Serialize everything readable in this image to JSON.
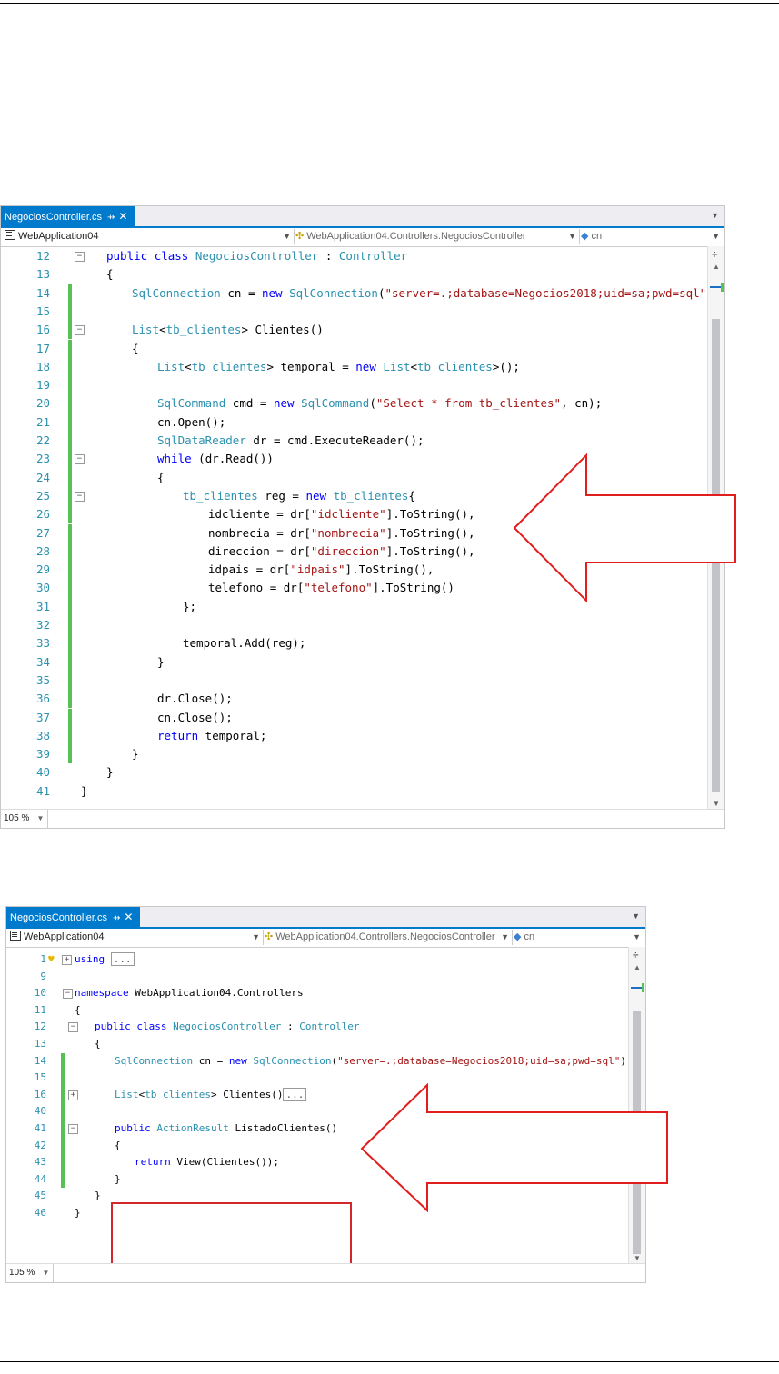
{
  "colors": {
    "accent": "#007acc",
    "keyword": "#0000ff",
    "type": "#2b91af",
    "string": "#a31515",
    "changed": "#57c155",
    "arrow": "#e11d1d"
  },
  "window1": {
    "tab": {
      "title": "NegociosController.cs",
      "pin": "⇸",
      "close": "✕"
    },
    "nav": {
      "project": "WebApplication04",
      "class": "WebApplication04.Controllers.NegociosController",
      "member": "cn"
    },
    "zoom": "105 %",
    "lines": [
      {
        "n": "12",
        "html": "<span class='kw'>public</span> <span class='kw'>class</span> <span class='ty'>NegociosController</span> : <span class='ty'>Controller</span>"
      },
      {
        "n": "13",
        "html": "{"
      },
      {
        "n": "14",
        "html": "<span class='ty'>SqlConnection</span> cn = <span class='kw'>new</span> <span class='ty'>SqlConnection</span>(<span class='st'>\"server=.;database=Negocios2018;uid=sa;pwd=sql\"</span>);"
      },
      {
        "n": "15",
        "html": ""
      },
      {
        "n": "16",
        "html": "<span class='ty'>List</span>&lt;<span class='ty'>tb_clientes</span>&gt; Clientes()"
      },
      {
        "n": "17",
        "html": "{"
      },
      {
        "n": "18",
        "html": "<span class='ty'>List</span>&lt;<span class='ty'>tb_clientes</span>&gt; temporal = <span class='kw'>new</span> <span class='ty'>List</span>&lt;<span class='ty'>tb_clientes</span>&gt;();"
      },
      {
        "n": "19",
        "html": ""
      },
      {
        "n": "20",
        "html": "<span class='ty'>SqlCommand</span> cmd = <span class='kw'>new</span> <span class='ty'>SqlCommand</span>(<span class='st'>\"Select * from tb_clientes\"</span>, cn);"
      },
      {
        "n": "21",
        "html": "cn.Open();"
      },
      {
        "n": "22",
        "html": "<span class='ty'>SqlDataReader</span> dr = cmd.ExecuteReader();"
      },
      {
        "n": "23",
        "html": "<span class='kw'>while</span> (dr.Read())"
      },
      {
        "n": "24",
        "html": "{"
      },
      {
        "n": "25",
        "html": "<span class='ty'>tb_clientes</span> reg = <span class='kw'>new</span> <span class='ty'>tb_clientes</span>{"
      },
      {
        "n": "26",
        "html": "idcliente = dr[<span class='st'>\"idcliente\"</span>].ToString(),"
      },
      {
        "n": "27",
        "html": "nombrecia = dr[<span class='st'>\"nombrecia\"</span>].ToString(),"
      },
      {
        "n": "28",
        "html": "direccion = dr[<span class='st'>\"direccion\"</span>].ToString(),"
      },
      {
        "n": "29",
        "html": "idpais = dr[<span class='st'>\"idpais\"</span>].ToString(),"
      },
      {
        "n": "30",
        "html": "telefono = dr[<span class='st'>\"telefono\"</span>].ToString()"
      },
      {
        "n": "31",
        "html": "};"
      },
      {
        "n": "32",
        "html": ""
      },
      {
        "n": "33",
        "html": "temporal.Add(reg);"
      },
      {
        "n": "34",
        "html": "}"
      },
      {
        "n": "35",
        "html": ""
      },
      {
        "n": "36",
        "html": "dr.Close();"
      },
      {
        "n": "37",
        "html": "cn.Close();"
      },
      {
        "n": "38",
        "html": "<span class='kw'>return</span> temporal;"
      },
      {
        "n": "39",
        "html": "}"
      },
      {
        "n": "40",
        "html": "}"
      },
      {
        "n": "41",
        "html": "}"
      }
    ]
  },
  "window2": {
    "tab": {
      "title": "NegociosController.cs",
      "pin": "⇸",
      "close": "✕"
    },
    "nav": {
      "project": "WebApplication04",
      "class": "WebApplication04.Controllers.NegociosController",
      "member": "cn"
    },
    "zoom": "105 %",
    "lines": [
      {
        "n": "1",
        "html": "<span class='kw'>using</span> <span class='collapsed'>...</span>"
      },
      {
        "n": "9",
        "html": ""
      },
      {
        "n": "10",
        "html": "<span class='kw'>namespace</span> WebApplication04.Controllers"
      },
      {
        "n": "11",
        "html": "{"
      },
      {
        "n": "12",
        "html": "<span class='kw'>public</span> <span class='kw'>class</span> <span class='ty'>NegociosController</span> : <span class='ty'>Controller</span>"
      },
      {
        "n": "13",
        "html": "{"
      },
      {
        "n": "14",
        "html": "<span class='ty'>SqlConnection</span> cn = <span class='kw'>new</span> <span class='ty'>SqlConnection</span>(<span class='st'>\"server=.;database=Negocios2018;uid=sa;pwd=sql\"</span>);"
      },
      {
        "n": "15",
        "html": ""
      },
      {
        "n": "16",
        "html": "<span class='ty'>List</span>&lt;<span class='ty'>tb_clientes</span>&gt; Clientes()<span class='collapsed'>...</span>"
      },
      {
        "n": "40",
        "html": ""
      },
      {
        "n": "41",
        "html": "<span class='kw'>public</span> <span class='ty'>ActionResult</span> ListadoClientes()"
      },
      {
        "n": "42",
        "html": "{"
      },
      {
        "n": "43",
        "html": "<span class='kw'>return</span> View(Clientes());"
      },
      {
        "n": "44",
        "html": "}"
      },
      {
        "n": "45",
        "html": "}"
      },
      {
        "n": "46",
        "html": "}"
      }
    ]
  }
}
